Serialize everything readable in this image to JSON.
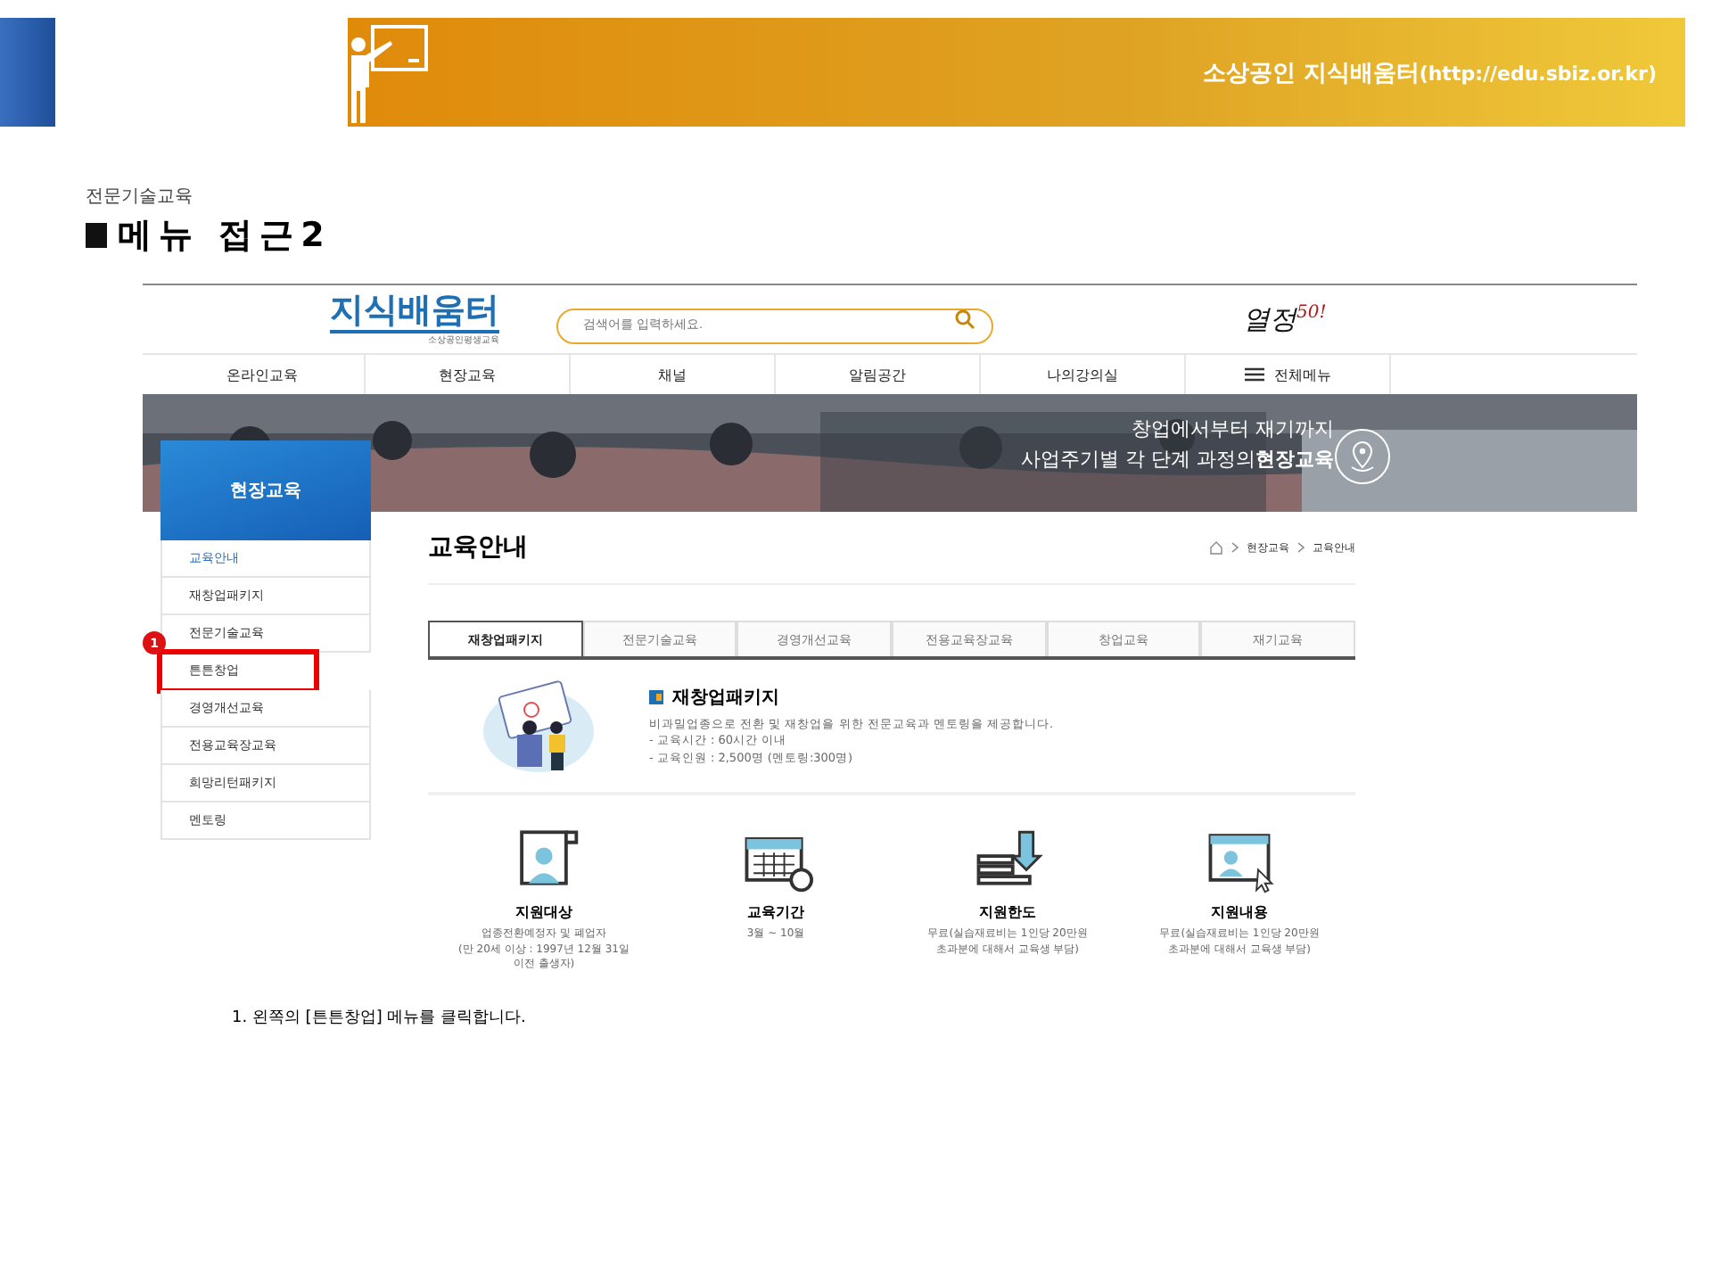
{
  "slide_header": {
    "site_label": "소상공인 지식배움터",
    "site_url": "(http://edu.sbiz.or.kr)"
  },
  "section_label": "전문기술교육",
  "slide_title": "메뉴 접근2",
  "website": {
    "logo": {
      "title": "지식배움터",
      "subtitle": "소상공인평생교육"
    },
    "search": {
      "placeholder": "검색어를 입력하세요."
    },
    "promo_logo": {
      "text": "열정",
      "number": "50!"
    },
    "nav": [
      {
        "label": "온라인교육",
        "kind": "link"
      },
      {
        "label": "현장교육",
        "kind": "link"
      },
      {
        "label": "채널",
        "kind": "link"
      },
      {
        "label": "알림공간",
        "kind": "link"
      },
      {
        "label": "나의강의실",
        "kind": "link"
      },
      {
        "label": "전체메뉴",
        "kind": "menu"
      }
    ],
    "hero": {
      "lines": [
        "창업에서부터 재기까지",
        "사업주기별 각 단계 과정의**현장교육**"
      ]
    },
    "sidebar": {
      "title": "현장교육",
      "items": [
        {
          "label": "교육안내",
          "selected": true,
          "boxed": false
        },
        {
          "label": "재창업패키지",
          "selected": false,
          "boxed": false
        },
        {
          "label": "전문기술교육",
          "selected": false,
          "boxed": false
        },
        {
          "label": "튼튼창업",
          "selected": false,
          "boxed": true,
          "callout": "1"
        },
        {
          "label": "경영개선교육",
          "selected": false,
          "boxed": false
        },
        {
          "label": "전용교육장교육",
          "selected": false,
          "boxed": false
        },
        {
          "label": "희망리턴패키지",
          "selected": false,
          "boxed": false
        },
        {
          "label": "멘토링",
          "selected": false,
          "boxed": false
        }
      ]
    },
    "page_title": "교육안내",
    "breadcrumb": [
      "현장교육",
      "교육안내"
    ],
    "tabs": [
      {
        "label": "재창업패키지",
        "selected": true
      },
      {
        "label": "전문기술교육",
        "selected": false
      },
      {
        "label": "경영개선교육",
        "selected": false
      },
      {
        "label": "전용교육장교육",
        "selected": false
      },
      {
        "label": "창업교육",
        "selected": false
      },
      {
        "label": "재기교육",
        "selected": false
      }
    ],
    "intro": {
      "title": "재창업패키지",
      "lines": [
        "비과밀업종으로 전환 및 재창업을 위한 전문교육과 멘토링을 제공합니다.",
        "- 교육시간 : 60시간 이내",
        "- 교육인원 : 2,500명 (멘토링:300명)"
      ]
    },
    "features": [
      {
        "title": "지원대상",
        "lines": [
          "업종전환예정자 및 폐업자",
          "(만 20세 이상 : 1997년 12월 31일",
          "이전 출생자)"
        ]
      },
      {
        "title": "교육기간",
        "lines": [
          "3월 ~ 10월"
        ]
      },
      {
        "title": "지원한도",
        "lines": [
          "무료(실습재료비는 1인당 20만원",
          "초과분에 대해서 교육생 부담)"
        ]
      },
      {
        "title": "지원내용",
        "lines": [
          "무료(실습재료비는 1인당 20만원",
          "초과분에 대해서 교육생 부담)"
        ]
      }
    ]
  },
  "caption": "1. 왼쪽의 [튼튼창업] 메뉴를 클릭합니다."
}
